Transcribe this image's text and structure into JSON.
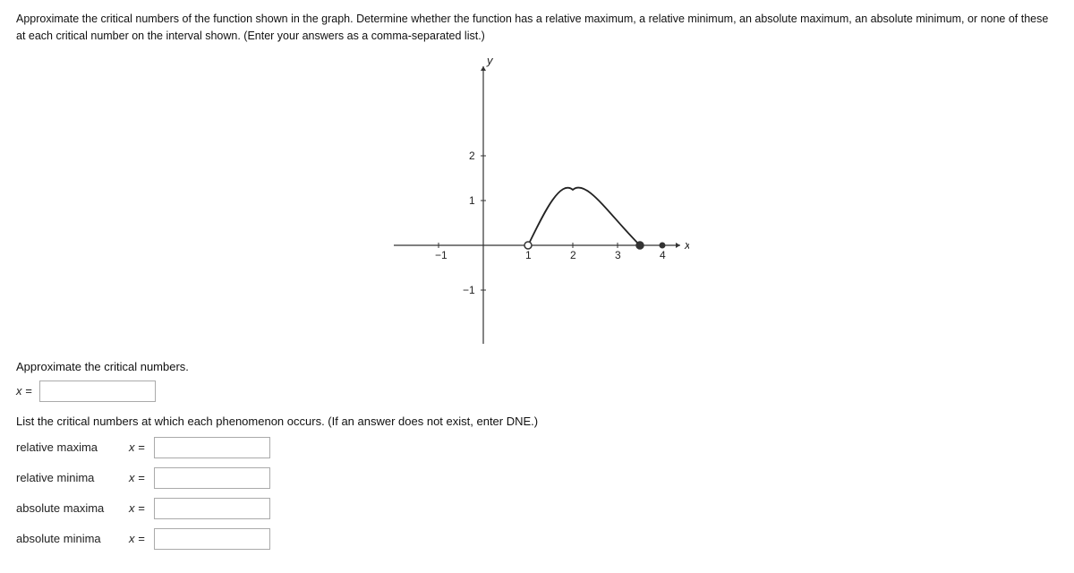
{
  "instructions": "Approximate the critical numbers of the function shown in the graph. Determine whether the function has a relative maximum, a relative minimum, an absolute maximum, an absolute minimum, or none of these at each critical number on the interval shown. (Enter your answers as a comma-separated list.)",
  "graph": {
    "xAxisLabel": "x",
    "yAxisLabel": "y",
    "xTicks": [
      -1,
      1,
      2,
      3,
      4
    ],
    "yTicks": [
      -1,
      1,
      2
    ]
  },
  "critical_numbers_label": "Approximate the critical numbers.",
  "critical_numbers_x_label": "x =",
  "list_phenomena_label": "List the critical numbers at which each phenomenon occurs. (If an answer does not exist, enter DNE.)",
  "phenomena": [
    {
      "id": "relative-maxima",
      "label": "relative maxima",
      "x_label": "x ="
    },
    {
      "id": "relative-minima",
      "label": "relative minima",
      "x_label": "x ="
    },
    {
      "id": "absolute-maxima",
      "label": "absolute maxima",
      "x_label": "x ="
    },
    {
      "id": "absolute-minima",
      "label": "absolute minima",
      "x_label": "x ="
    }
  ]
}
